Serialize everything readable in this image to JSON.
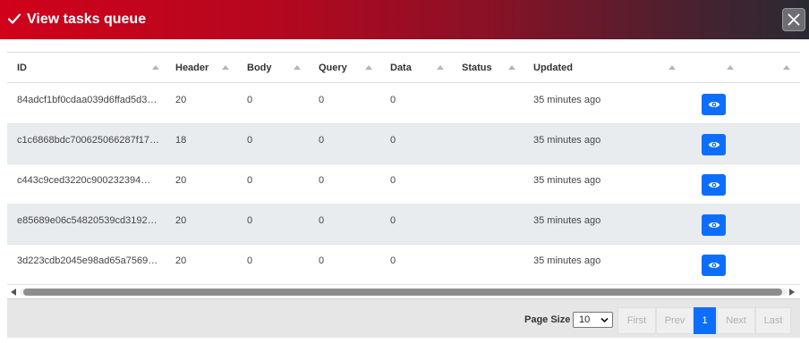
{
  "dialog": {
    "title": "View tasks queue",
    "close_symbol": "✕",
    "accent_color": "#d0011b"
  },
  "table": {
    "columns": [
      "ID",
      "Header",
      "Body",
      "Query",
      "Data",
      "Status",
      "Updated"
    ],
    "rows": [
      {
        "id": "84adcf1bf0cdaa039d6ffad5d3…",
        "header": "20",
        "body": "0",
        "query": "0",
        "data": "0",
        "status": "",
        "updated": "35 minutes ago",
        "action_icon": "eye-icon"
      },
      {
        "id": "c1c6868bdc700625066287f17…",
        "header": "18",
        "body": "0",
        "query": "0",
        "data": "0",
        "status": "",
        "updated": "35 minutes ago",
        "action_icon": "eye-icon"
      },
      {
        "id": "c443c9ced3220c900232394…",
        "header": "20",
        "body": "0",
        "query": "0",
        "data": "0",
        "status": "",
        "updated": "35 minutes ago",
        "action_icon": "eye-icon"
      },
      {
        "id": "e85689e06c54820539cd3192…",
        "header": "20",
        "body": "0",
        "query": "0",
        "data": "0",
        "status": "",
        "updated": "35 minutes ago",
        "action_icon": "eye-icon"
      },
      {
        "id": "3d223cdb2045e98ad65a7569…",
        "header": "20",
        "body": "0",
        "query": "0",
        "data": "0",
        "status": "",
        "updated": "35 minutes ago",
        "action_icon": "eye-icon"
      }
    ]
  },
  "pagination": {
    "page_size_label": "Page Size",
    "page_size_value": "10",
    "first_label": "First",
    "prev_label": "Prev",
    "current_page": "1",
    "next_label": "Next",
    "last_label": "Last"
  }
}
